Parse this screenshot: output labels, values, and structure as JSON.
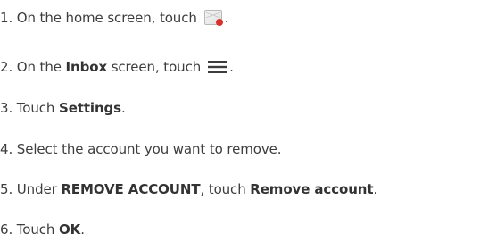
{
  "steps": [
    {
      "prefix": "1. On the home screen, touch",
      "icon": "email-app-icon",
      "suffix": "."
    },
    {
      "prefix": "2. On the ",
      "bold": "Inbox",
      "middle": " screen, touch",
      "icon": "menu-icon",
      "suffix": "."
    },
    {
      "prefix": "3. Touch ",
      "bold": "Settings",
      "suffix": "."
    },
    {
      "text": "4. Select the account you want to remove."
    },
    {
      "prefix": "5. Under ",
      "bold": "REMOVE ACCOUNT",
      "middle": ", touch ",
      "bold2": "Remove account",
      "suffix": "."
    },
    {
      "prefix": "6. Touch ",
      "bold": "OK",
      "suffix": "."
    }
  ],
  "colors": {
    "text": "#3d3d3d",
    "icon_badge": "#d9322c"
  }
}
